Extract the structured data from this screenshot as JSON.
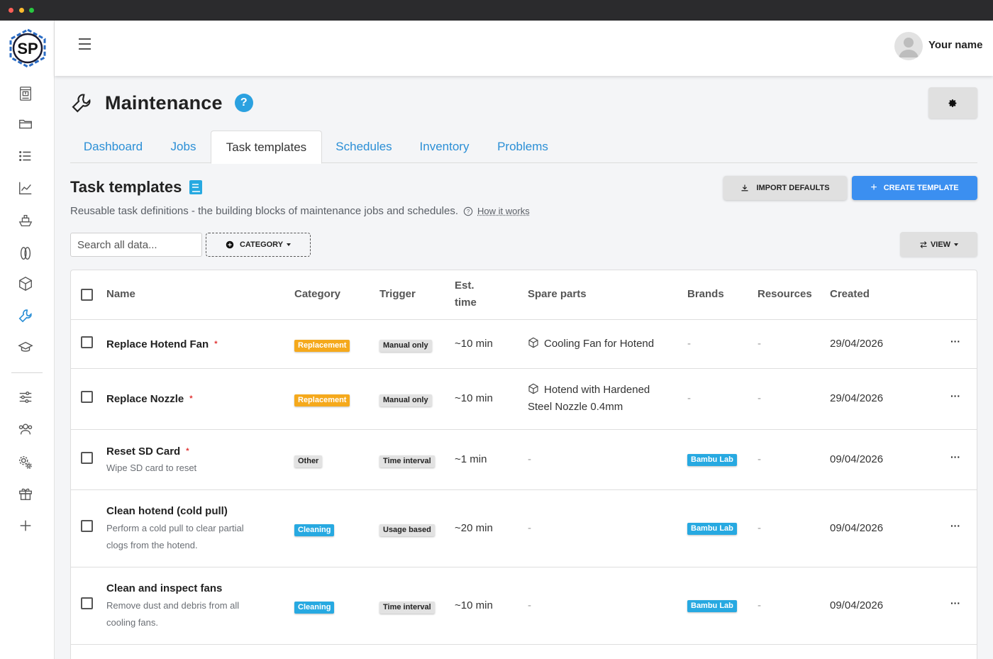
{
  "app": {
    "logo_text": "SP",
    "user_name": "Your name"
  },
  "page": {
    "title": "Maintenance",
    "help_label": "?"
  },
  "tabs": [
    {
      "label": "Dashboard"
    },
    {
      "label": "Jobs"
    },
    {
      "label": "Task templates"
    },
    {
      "label": "Schedules"
    },
    {
      "label": "Inventory"
    },
    {
      "label": "Problems"
    }
  ],
  "active_tab": "Task templates",
  "section": {
    "title": "Task templates",
    "subtitle": "Reusable task definitions - the building blocks of maintenance jobs and schedules.",
    "how_link": "How it works"
  },
  "toolbar": {
    "import_label": "IMPORT DEFAULTS",
    "create_label": "CREATE TEMPLATE",
    "search_placeholder": "Search all data...",
    "category_label": "CATEGORY",
    "view_label": "VIEW"
  },
  "table": {
    "headers": {
      "name": "Name",
      "category": "Category",
      "trigger": "Trigger",
      "est_time_1": "Est.",
      "est_time_2": "time",
      "spare_parts": "Spare parts",
      "brands": "Brands",
      "resources": "Resources",
      "created": "Created"
    },
    "rows": [
      {
        "name": "Replace Hotend Fan",
        "required": "*",
        "description": "",
        "category": "Replacement",
        "trigger": "Manual only",
        "time": "~10 min",
        "spare_parts_1": "Cooling Fan for Hotend",
        "spare_parts_2": "",
        "brands": "-",
        "resources": "-",
        "created": "29/04/2026",
        "menu": "···"
      },
      {
        "name": "Replace Nozzle",
        "required": "*",
        "description": "",
        "category": "Replacement",
        "trigger": "Manual only",
        "time": "~10 min",
        "spare_parts_1": "Hotend with Hardened",
        "spare_parts_2": "Steel Nozzle 0.4mm",
        "brands": "-",
        "resources": "-",
        "created": "29/04/2026",
        "menu": "···"
      },
      {
        "name": "Reset SD Card",
        "required": "*",
        "description": "Wipe SD card to reset",
        "category": "Other",
        "trigger": "Time interval",
        "time": "~1 min",
        "spare_parts_1": "-",
        "spare_parts_2": "",
        "brands": "Bambu Lab",
        "resources": "-",
        "created": "09/04/2026",
        "menu": "···"
      },
      {
        "name": "Clean hotend (cold pull)",
        "required": "",
        "description_1": "Perform a cold pull to clear partial",
        "description_2": "clogs from the hotend.",
        "category": "Cleaning",
        "trigger": "Usage based",
        "time": "~20 min",
        "spare_parts_1": "-",
        "spare_parts_2": "",
        "brands": "Bambu Lab",
        "resources": "-",
        "created": "09/04/2026",
        "menu": "···"
      },
      {
        "name": "Clean and inspect fans",
        "required": "",
        "description_1": "Remove dust and debris from all",
        "description_2": "cooling fans.",
        "category": "Cleaning",
        "trigger": "Time interval",
        "time": "~10 min",
        "spare_parts_1": "-",
        "spare_parts_2": "",
        "brands": "Bambu Lab",
        "resources": "-",
        "created": "09/04/2026",
        "menu": "···"
      }
    ]
  },
  "sidebar_icons": [
    "printer-icon",
    "folder-icon",
    "list-icon",
    "chart-icon",
    "ship-icon",
    "filament-icon",
    "box-icon",
    "wrench-icon",
    "graduation-cap-icon",
    "sliders-icon",
    "users-icon",
    "cogs-icon",
    "gift-icon",
    "plus-icon"
  ],
  "colors": {
    "accent": "#3b8ff0",
    "link": "#2b8fd6",
    "replacement": "#f5a91c",
    "cleaning": "#27a9e1",
    "required": "#e03131",
    "active_sidebar": "#2b8fd6"
  }
}
